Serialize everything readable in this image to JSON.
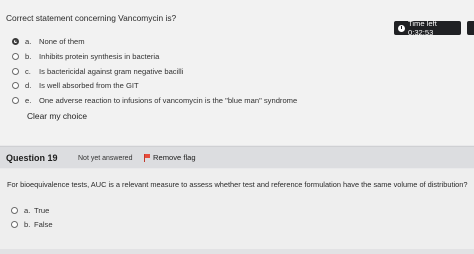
{
  "question18": {
    "text": "Correct statement concerning Vancomycin is?",
    "timer": "Time left 0:32:53",
    "options": [
      {
        "letter": "a.",
        "text": "None of them",
        "checked": true
      },
      {
        "letter": "b.",
        "text": "Inhibits protein synthesis in bacteria",
        "checked": false
      },
      {
        "letter": "c.",
        "text": "Is bactericidal against gram negative bacilli",
        "checked": false
      },
      {
        "letter": "d.",
        "text": "Is well absorbed from the GIT",
        "checked": false
      },
      {
        "letter": "e.",
        "text": "One adverse reaction to infusions of vancomycin is the \"blue man\" syndrome",
        "checked": false
      }
    ],
    "clear_choice": "Clear my choice"
  },
  "question19": {
    "label": "Question 19",
    "state": "Not yet answered",
    "flag": "Remove flag",
    "text": "For bioequivalence tests, AUC is a relevant measure to assess whether test and reference formulation have the same volume of distribution?",
    "options": [
      {
        "letter": "a.",
        "text": "True"
      },
      {
        "letter": "b.",
        "text": "False"
      }
    ]
  }
}
